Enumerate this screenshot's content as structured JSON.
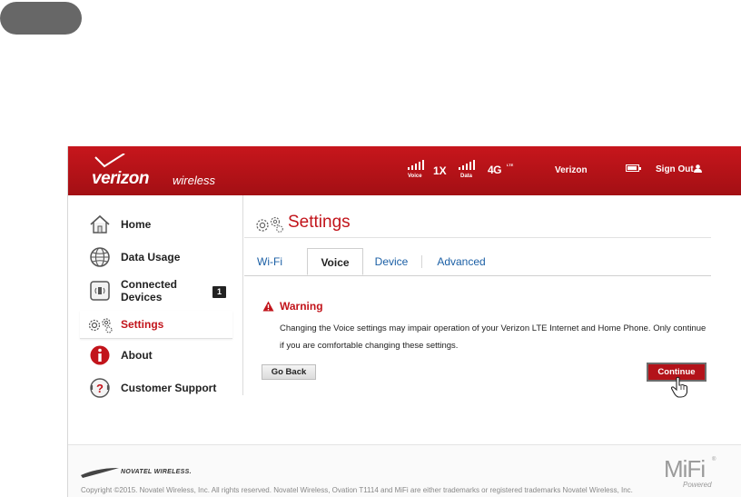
{
  "header": {
    "brand_main": "verizon",
    "brand_sub": "wireless",
    "voice_label": "Voice",
    "voice_tech": "1X",
    "data_label": "Data",
    "data_tech": "4G",
    "data_tech_sup": "LTE",
    "carrier": "Verizon",
    "sign_out": "Sign Out"
  },
  "sidebar": {
    "items": [
      {
        "label": "Home",
        "icon": "home-icon"
      },
      {
        "label": "Data Usage",
        "icon": "globe-icon"
      },
      {
        "label": "Connected Devices",
        "line1": "Connected",
        "line2": "Devices",
        "badge": "1",
        "icon": "device-icon"
      },
      {
        "label": "Settings",
        "icon": "gears-icon",
        "active": true
      },
      {
        "label": "About",
        "icon": "info-icon"
      },
      {
        "label": "Customer Support",
        "icon": "support-icon"
      }
    ]
  },
  "main": {
    "title": "Settings",
    "tabs": [
      "Wi-Fi",
      "Voice",
      "Device",
      "Advanced"
    ],
    "selected_tab": "Voice",
    "warning": {
      "title": "Warning",
      "text": "Changing the Voice settings may impair operation of your Verizon LTE Internet and Home Phone. Only continue if you are comfortable changing these settings."
    },
    "buttons": {
      "back": "Go Back",
      "continue": "Continue"
    }
  },
  "footer": {
    "vendor": "NOVATEL WIRELESS.",
    "copyright": "Copyright ©2015. Novatel Wireless, Inc. All rights reserved. Novatel Wireless, Ovation T1114 and MiFi are either trademarks or registered trademarks Novatel Wireless, Inc.",
    "mifi": "MiFi",
    "mifi_reg": "®",
    "mifi_sub": "Powered"
  },
  "colors": {
    "brand_red": "#c2141b",
    "link_blue": "#1b5fa5"
  }
}
